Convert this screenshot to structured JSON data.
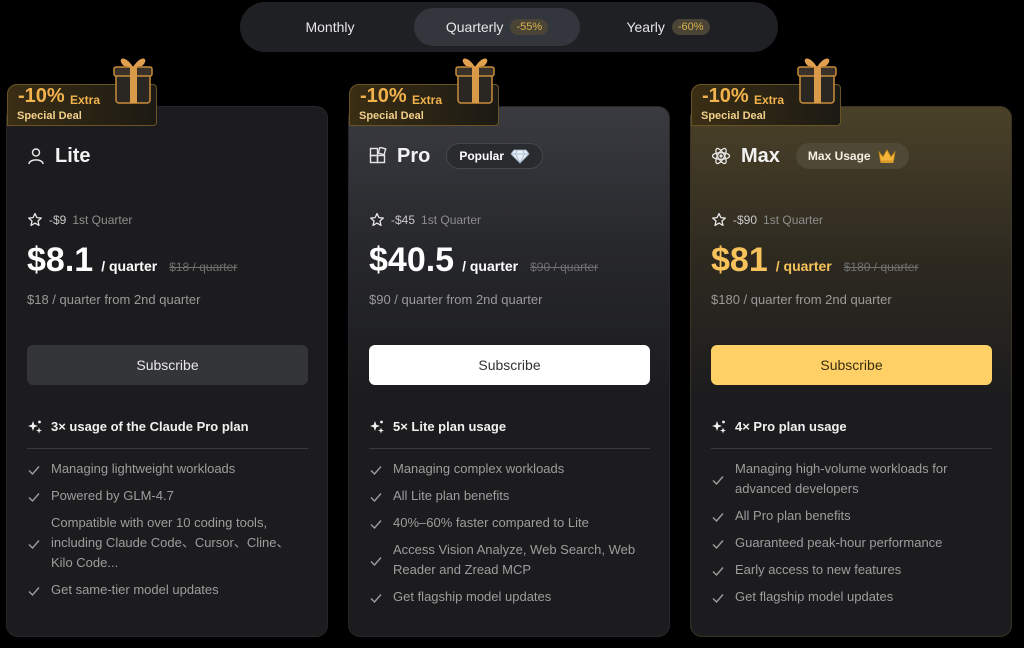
{
  "toggle": {
    "monthly": "Monthly",
    "quarterly": "Quarterly",
    "quarterly_discount": "-55%",
    "yearly": "Yearly",
    "yearly_discount": "-60%",
    "selected": "Quarterly"
  },
  "deal": {
    "pct": "-10%",
    "extra": "Extra",
    "special": "Special Deal"
  },
  "plans": [
    {
      "name": "Lite",
      "icon": "user-icon",
      "quarter_off": "-$9",
      "quarter_label": "1st Quarter",
      "price": "$8.1",
      "per": "/ quarter",
      "strike": "$18 / quarter",
      "from": "$18 / quarter from 2nd quarter",
      "button": "Subscribe",
      "feature_head": "3× usage of the Claude Pro plan",
      "features": [
        "Managing lightweight workloads",
        "Powered by GLM-4.7",
        "Compatible with over 10 coding tools, including Claude Code、Cursor、Cline、Kilo Code...",
        "Get same-tier model updates"
      ]
    },
    {
      "name": "Pro",
      "icon": "grid-icon",
      "badge": "Popular",
      "badge_icon": "diamond-icon",
      "quarter_off": "-$45",
      "quarter_label": "1st Quarter",
      "price": "$40.5",
      "per": "/ quarter",
      "strike": "$90 / quarter",
      "from": "$90 / quarter from 2nd quarter",
      "button": "Subscribe",
      "feature_head": "5× Lite plan usage",
      "features": [
        "Managing complex workloads",
        "All Lite plan benefits",
        "40%–60% faster compared to Lite",
        "Access Vision Analyze, Web Search, Web Reader and Zread MCP",
        "Get flagship model updates"
      ]
    },
    {
      "name": "Max",
      "icon": "atom-icon",
      "badge": "Max Usage",
      "badge_icon": "crown-icon",
      "quarter_off": "-$90",
      "quarter_label": "1st Quarter",
      "price": "$81",
      "per": "/ quarter",
      "strike": "$180 / quarter",
      "from": "$180 / quarter from 2nd quarter",
      "button": "Subscribe",
      "feature_head": "4× Pro plan usage",
      "features": [
        "Managing high-volume workloads for advanced developers",
        "All Pro plan benefits",
        "Guaranteed peak-hour performance",
        "Early access to new features",
        "Get flagship model updates"
      ]
    }
  ],
  "colors": {
    "accent_gold": "#f7c35a",
    "max_button": "#ffd066",
    "deal_orange": "#f2b24c"
  }
}
